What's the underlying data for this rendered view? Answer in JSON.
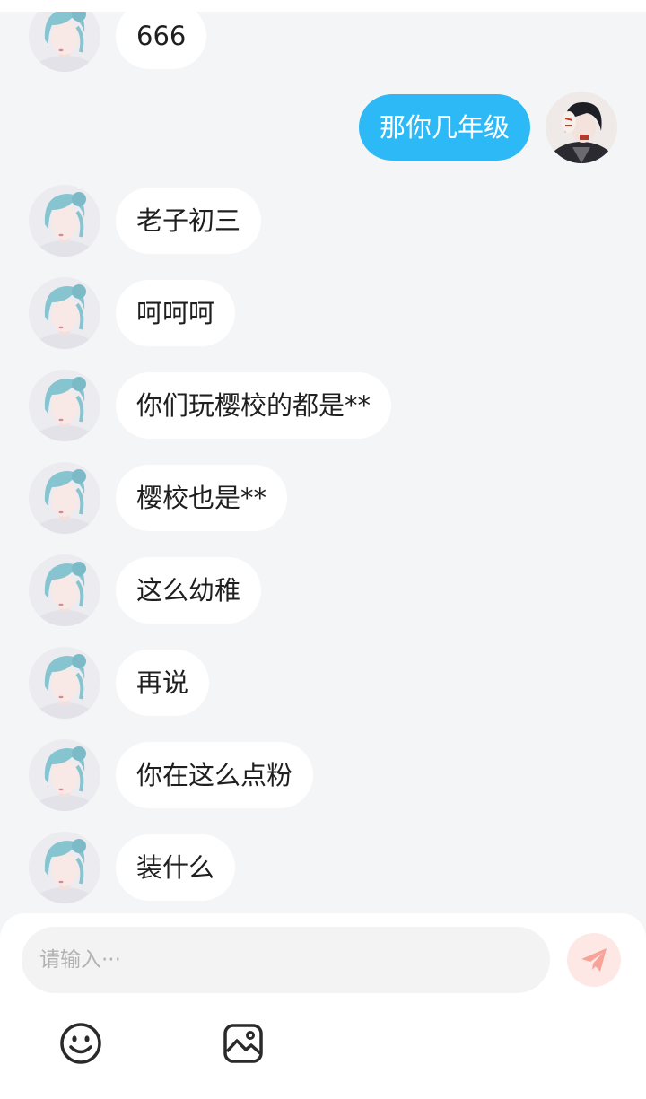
{
  "colors": {
    "background": "#f4f5f7",
    "incoming_bubble": "#ffffff",
    "outgoing_bubble": "#2db8f6",
    "send_button": "#fde8e6",
    "send_icon": "#f8a39a"
  },
  "chat": {
    "messages": [
      {
        "side": "left",
        "avatar": "blue-hair-avatar",
        "text": "666"
      },
      {
        "side": "right",
        "avatar": "dark-hair-mask-avatar",
        "text": "那你几年级"
      },
      {
        "side": "left",
        "avatar": "blue-hair-avatar",
        "text": "老子初三"
      },
      {
        "side": "left",
        "avatar": "blue-hair-avatar",
        "text": "呵呵呵"
      },
      {
        "side": "left",
        "avatar": "blue-hair-avatar",
        "text": "你们玩樱校的都是**"
      },
      {
        "side": "left",
        "avatar": "blue-hair-avatar",
        "text": "樱校也是**"
      },
      {
        "side": "left",
        "avatar": "blue-hair-avatar",
        "text": "这么幼稚"
      },
      {
        "side": "left",
        "avatar": "blue-hair-avatar",
        "text": "再说"
      },
      {
        "side": "left",
        "avatar": "blue-hair-avatar",
        "text": "你在这么点粉"
      },
      {
        "side": "left",
        "avatar": "blue-hair-avatar",
        "text": "装什么"
      }
    ]
  },
  "composer": {
    "placeholder": "请输入···",
    "value": "",
    "send_icon": "paper-plane-icon",
    "tools": [
      "smiley-icon",
      "image-icon"
    ]
  }
}
